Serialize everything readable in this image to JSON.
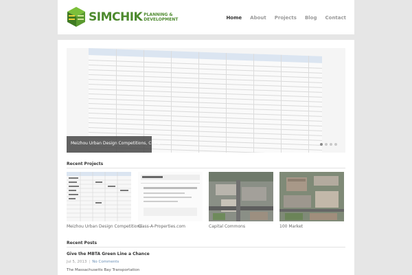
{
  "header": {
    "logo_name": "SIMCHIK",
    "logo_sub_line1": "PLANNING &",
    "logo_sub_line2": "DEVELOPMENT",
    "nav": [
      {
        "label": "Home",
        "active": true
      },
      {
        "label": "About",
        "active": false
      },
      {
        "label": "Projects",
        "active": false
      },
      {
        "label": "Blog",
        "active": false
      },
      {
        "label": "Contact",
        "active": false
      }
    ]
  },
  "slider": {
    "caption": "Meizhou Urban Design Competitions, China",
    "slide_count": 4,
    "active_slide": 1
  },
  "recent_projects": {
    "title": "Recent Projects",
    "items": [
      {
        "label": "Meizhou Urban Design Competitions",
        "image": "spreadsheet-thumbnail"
      },
      {
        "label": "Class-A-Properties.com",
        "image": "website-thumbnail"
      },
      {
        "label": "Capital Commons",
        "image": "aerial-photo-thumbnail"
      },
      {
        "label": "100 Market",
        "image": "aerial-photo-thumbnail"
      }
    ]
  },
  "recent_posts": {
    "title": "Recent Posts",
    "post": {
      "title": "Give the MBTA Green Line a Chance",
      "date": "Jul 5, 2013",
      "comments": "No Comments",
      "excerpt": "The Massachusetts Bay Transportation"
    }
  },
  "colors": {
    "brand_green": "#4d8a2e",
    "page_background": "#e6e6e6",
    "link_blue": "#6a8fb5"
  }
}
